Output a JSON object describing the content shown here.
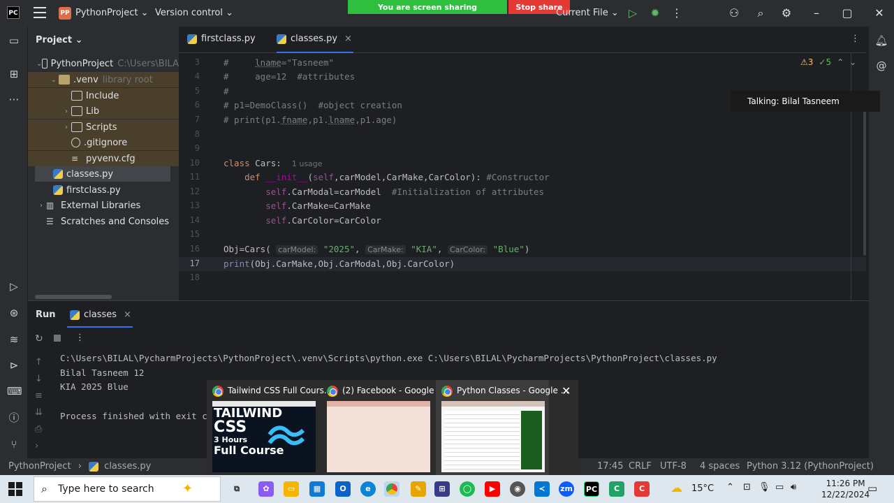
{
  "titlebar": {
    "logo": "PC",
    "project_badge": "PP",
    "project_name": "PythonProject ⌄",
    "vcs": "Version control ⌄",
    "sharing_banner": "You are screen sharing",
    "stop_share": "Stop share",
    "run_config": "Current File ⌄"
  },
  "project_panel": {
    "title": "Project ⌄",
    "tree": [
      {
        "label": "PythonProject",
        "hint": "C:\\Users\\BILA",
        "arrow": "⌄"
      },
      {
        "label": ".venv",
        "hint": "library root",
        "arrow": "⌄"
      },
      {
        "label": "Include",
        "hint": "",
        "arrow": ""
      },
      {
        "label": "Lib",
        "hint": "",
        "arrow": "›"
      },
      {
        "label": "Scripts",
        "hint": "",
        "arrow": "›"
      },
      {
        "label": ".gitignore",
        "hint": "",
        "arrow": ""
      },
      {
        "label": "pyvenv.cfg",
        "hint": "",
        "arrow": ""
      },
      {
        "label": "classes.py",
        "hint": "",
        "arrow": ""
      },
      {
        "label": "firstclass.py",
        "hint": "",
        "arrow": ""
      },
      {
        "label": "External Libraries",
        "hint": "",
        "arrow": "›"
      },
      {
        "label": "Scratches and Consoles",
        "hint": "",
        "arrow": ""
      }
    ]
  },
  "editor_tabs": [
    {
      "label": "firstclass.py"
    },
    {
      "label": "classes.py",
      "close": "×"
    }
  ],
  "editor": {
    "warnings": "⚠3",
    "checks": "✓5",
    "line_numbers": [
      "3",
      "4",
      "5",
      "6",
      "7",
      "8",
      "9",
      "10",
      "11",
      "12",
      "13",
      "14",
      "15",
      "16",
      "17",
      "18"
    ],
    "usage_hint": "1 usage",
    "inlay_carModel": "carModel:",
    "inlay_CarMake": "CarMake:",
    "inlay_CarColor": "CarColor:"
  },
  "talking": "Talking: Bilal Tasneem",
  "run_panel": {
    "title": "Run",
    "tab": "classes",
    "tab_close": "×",
    "console": [
      "C:\\Users\\BILAL\\PycharmProjects\\PythonProject\\.venv\\Scripts\\python.exe C:\\Users\\BILAL\\PycharmProjects\\PythonProject\\classes.py",
      "Bilal Tasneem 12",
      "KIA 2025 Blue",
      "",
      "Process finished with exit c"
    ]
  },
  "statusbar": {
    "crumb1": "PythonProject",
    "crumb2": "classes.py",
    "position": "17:45",
    "line_sep": "CRLF",
    "encoding": "UTF-8",
    "indent": "4 spaces",
    "interpreter": "Python 3.12 (PythonProject)"
  },
  "chrome_previews": [
    {
      "title": "Tailwind CSS Full Cours..."
    },
    {
      "title": "(2) Facebook - Google ..."
    },
    {
      "title": "Python Classes - Google ..."
    }
  ],
  "thumb_text": {
    "line1": "TAILWIND",
    "line2": "CSS",
    "line3": "3 Hours",
    "line4": "Full Course"
  },
  "taskbar": {
    "search_placeholder": "Type here to search",
    "temperature": "15°C",
    "time": "11:26 PM",
    "date": "12/22/2024"
  }
}
